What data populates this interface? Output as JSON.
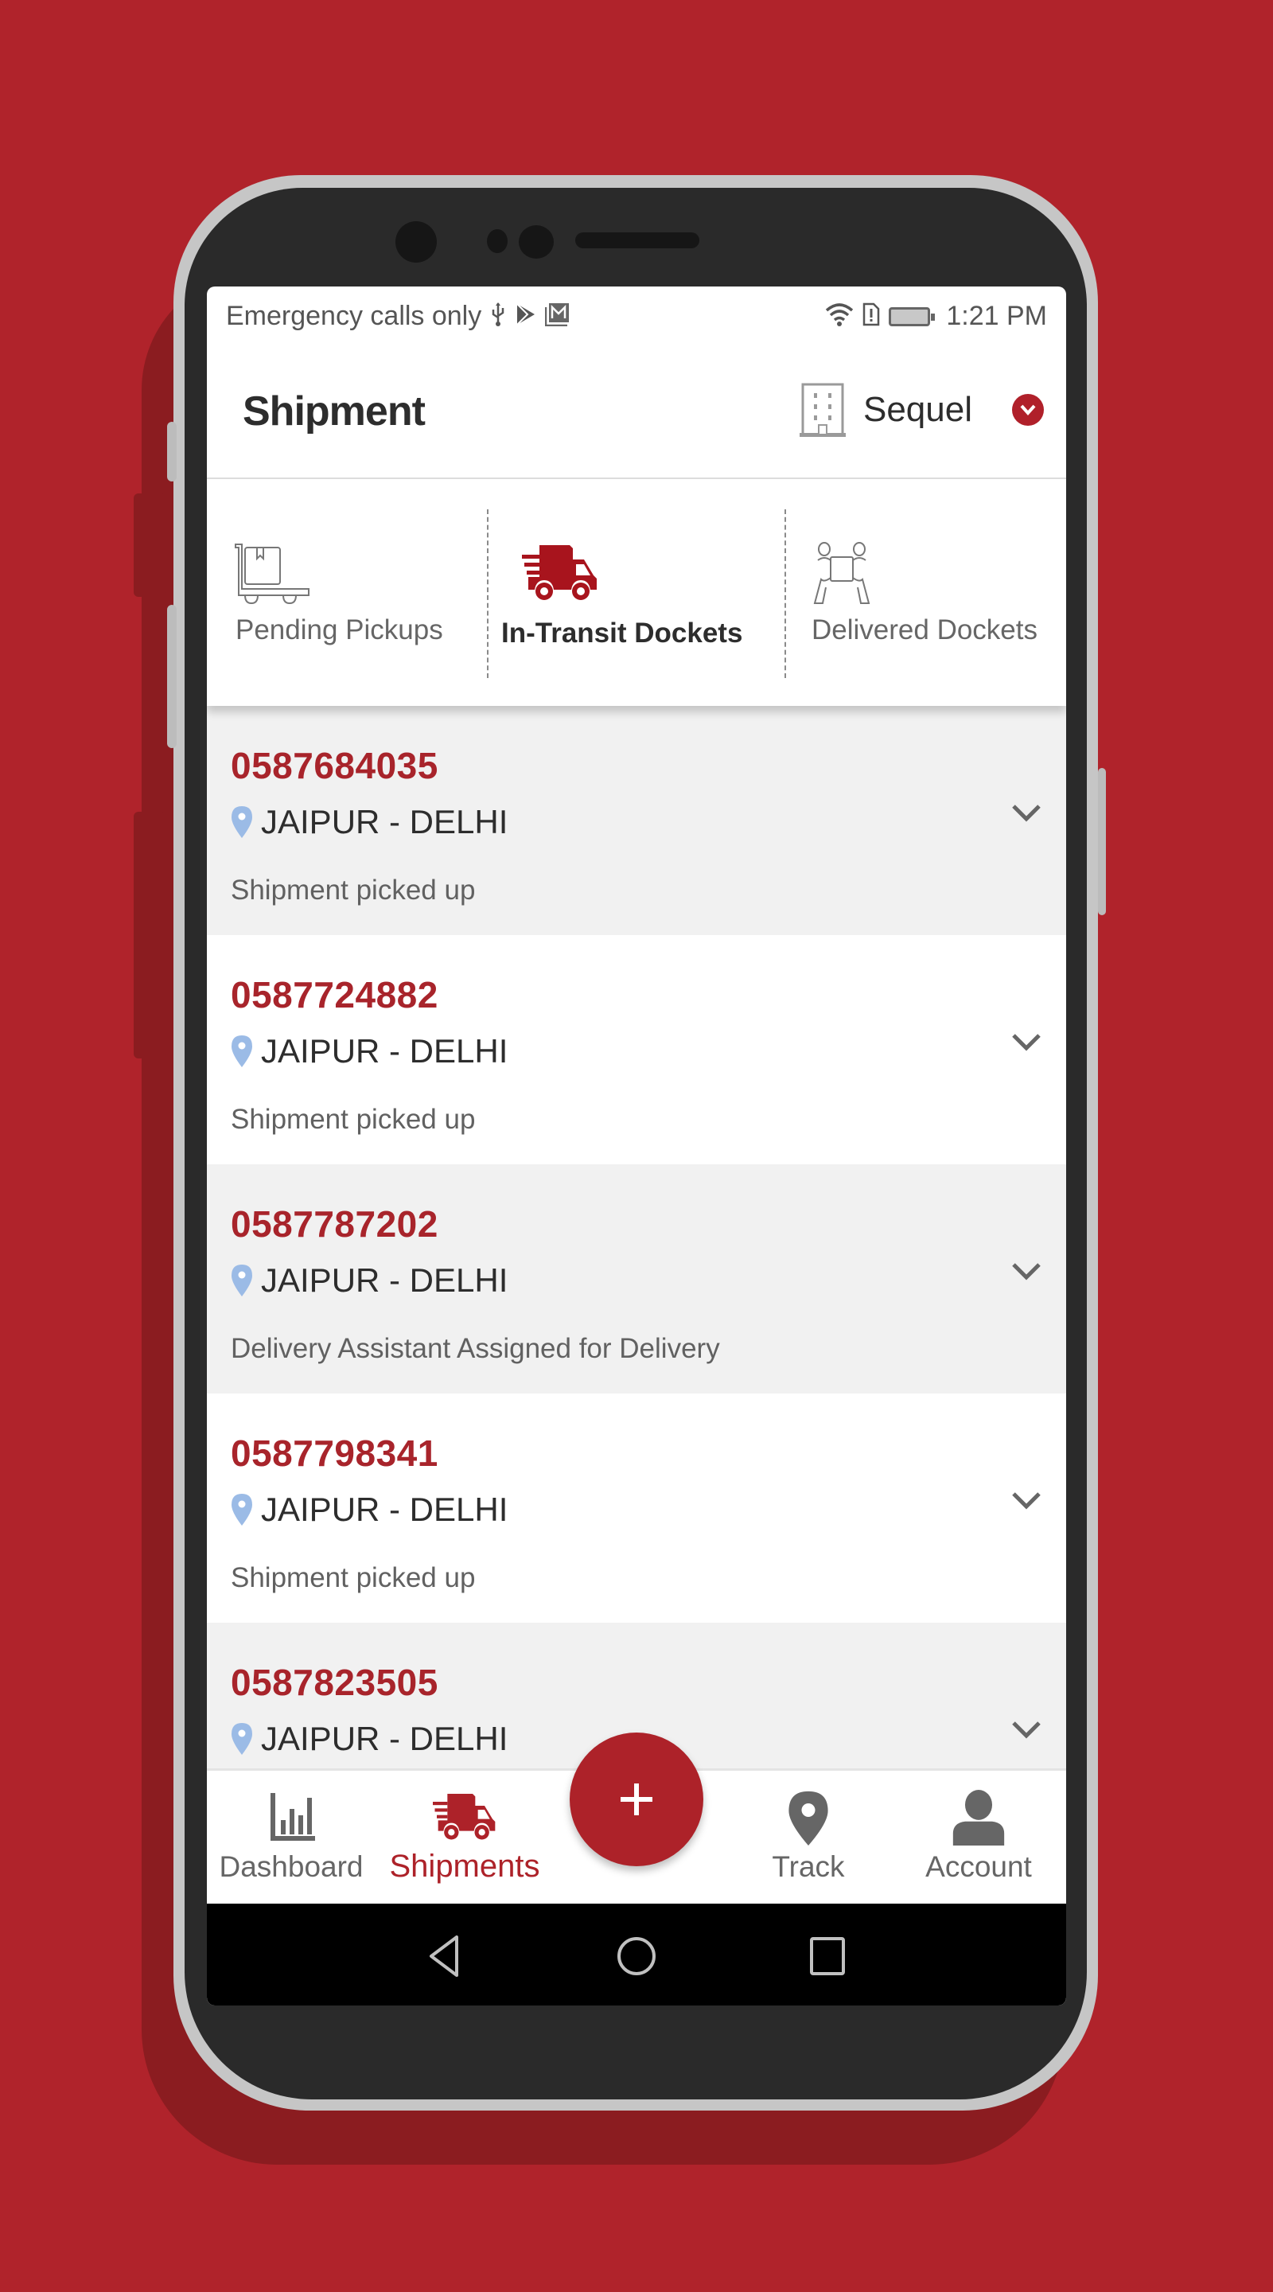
{
  "status_bar": {
    "left_text": "Emergency calls only",
    "left_icons": [
      "usb-icon",
      "play-store-icon",
      "gmail-icon"
    ],
    "right_icons": [
      "wifi-icon",
      "sim-alert-icon",
      "battery-charging-icon"
    ],
    "time": "1:21 PM"
  },
  "header": {
    "title": "Shipment",
    "company": "Sequel",
    "company_icon": "building-icon",
    "dropdown_icon": "chevron-down-circle-icon"
  },
  "tabs": [
    {
      "label": "Pending Pickups",
      "icon": "trolley-box-icon",
      "active": false
    },
    {
      "label": "In-Transit Dockets",
      "icon": "delivery-truck-icon",
      "active": true
    },
    {
      "label": "Delivered Dockets",
      "icon": "people-carrying-box-icon",
      "active": false
    }
  ],
  "dockets": [
    {
      "number": "0587684035",
      "route": "JAIPUR - DELHI",
      "status": "Shipment picked up"
    },
    {
      "number": "0587724882",
      "route": "JAIPUR - DELHI",
      "status": "Shipment picked up"
    },
    {
      "number": "0587787202",
      "route": "JAIPUR - DELHI",
      "status": "Delivery Assistant Assigned for Delivery"
    },
    {
      "number": "0587798341",
      "route": "JAIPUR - DELHI",
      "status": "Shipment picked up"
    },
    {
      "number": "0587823505",
      "route": "JAIPUR - DELHI",
      "status": ""
    }
  ],
  "bottom_nav": [
    {
      "label": "Dashboard",
      "icon": "bar-chart-icon",
      "active": false
    },
    {
      "label": "Shipments",
      "icon": "delivery-truck-icon",
      "active": true
    },
    {
      "label": "Track",
      "icon": "map-pin-icon",
      "active": false
    },
    {
      "label": "Account",
      "icon": "user-icon",
      "active": false
    }
  ],
  "fab": {
    "label": "+",
    "icon": "plus-icon"
  },
  "android_nav": [
    "back-icon",
    "home-icon",
    "recents-icon"
  ],
  "colors": {
    "brand": "#ad2229",
    "background": "#b0232b",
    "docket_number": "#a8242b",
    "pin": "#9bbbe6",
    "shaded_row": "#f1f1f1"
  }
}
